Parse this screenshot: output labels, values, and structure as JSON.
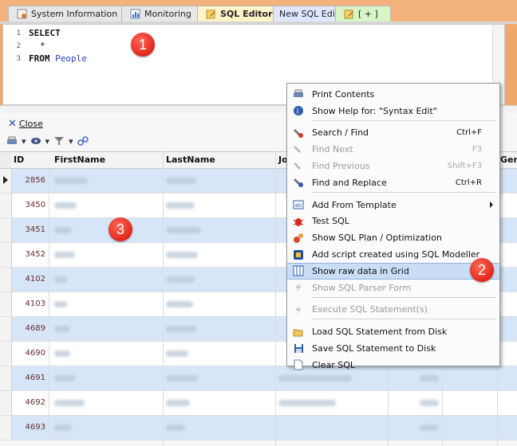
{
  "tabs": [
    {
      "label": "System Information",
      "icon": "system-info-icon"
    },
    {
      "label": "Monitoring",
      "icon": "monitoring-icon"
    },
    {
      "label": "SQL Editor",
      "icon": "sql-editor-icon",
      "active": true
    },
    {
      "label": "New SQL Edit"
    },
    {
      "label": "[ + ]",
      "icon": "new-tab-icon"
    }
  ],
  "editor": {
    "line_numbers": [
      "1",
      "2",
      "3"
    ],
    "line1": "SELECT",
    "line2": "*",
    "line3_keyword": "FROM",
    "line3_object": "People"
  },
  "results": {
    "close_label": "Close",
    "columns": [
      "ID",
      "FirstName",
      "LastName",
      "Jo",
      "Gen"
    ],
    "ids": [
      "2856",
      "3450",
      "3451",
      "3452",
      "4102",
      "4103",
      "4689",
      "4690",
      "4691",
      "4692",
      "4693"
    ]
  },
  "context_menu": {
    "items": [
      {
        "label": "Print Contents",
        "icon": "printer-icon"
      },
      {
        "label": "Show Help for: \"Syntax Edit\"",
        "icon": "help-icon"
      },
      {
        "label": "Search / Find",
        "shortcut": "Ctrl+F",
        "icon": "search-icon"
      },
      {
        "label": "Find Next",
        "shortcut": "F3",
        "disabled": true,
        "icon": "find-next-icon"
      },
      {
        "label": "Find Previous",
        "shortcut": "Shift+F3",
        "disabled": true,
        "icon": "find-previous-icon"
      },
      {
        "label": "Find and Replace",
        "shortcut": "Ctrl+R",
        "icon": "replace-icon"
      },
      {
        "label": "Add From Template",
        "icon": "template-icon",
        "submenu": true
      },
      {
        "label": "Test SQL",
        "icon": "bug-icon"
      },
      {
        "label": "Show SQL Plan / Optimization",
        "icon": "plan-icon"
      },
      {
        "label": "Add script created using SQL Modeller",
        "icon": "modeller-icon"
      },
      {
        "label": "Show raw data in Grid",
        "icon": "grid-icon",
        "highlighted": true
      },
      {
        "label": "Show SQL Parser Form",
        "icon": "parser-icon",
        "disabled": true
      },
      {
        "label": "Execute SQL Statement(s)",
        "icon": "lightning-icon",
        "disabled": true
      },
      {
        "label": "Load SQL Statement from Disk",
        "icon": "folder-open-icon"
      },
      {
        "label": "Save SQL Statement to Disk",
        "icon": "save-icon"
      },
      {
        "label": "Clear SQL",
        "icon": "clear-icon"
      }
    ]
  },
  "callouts": [
    "1",
    "2",
    "3"
  ]
}
